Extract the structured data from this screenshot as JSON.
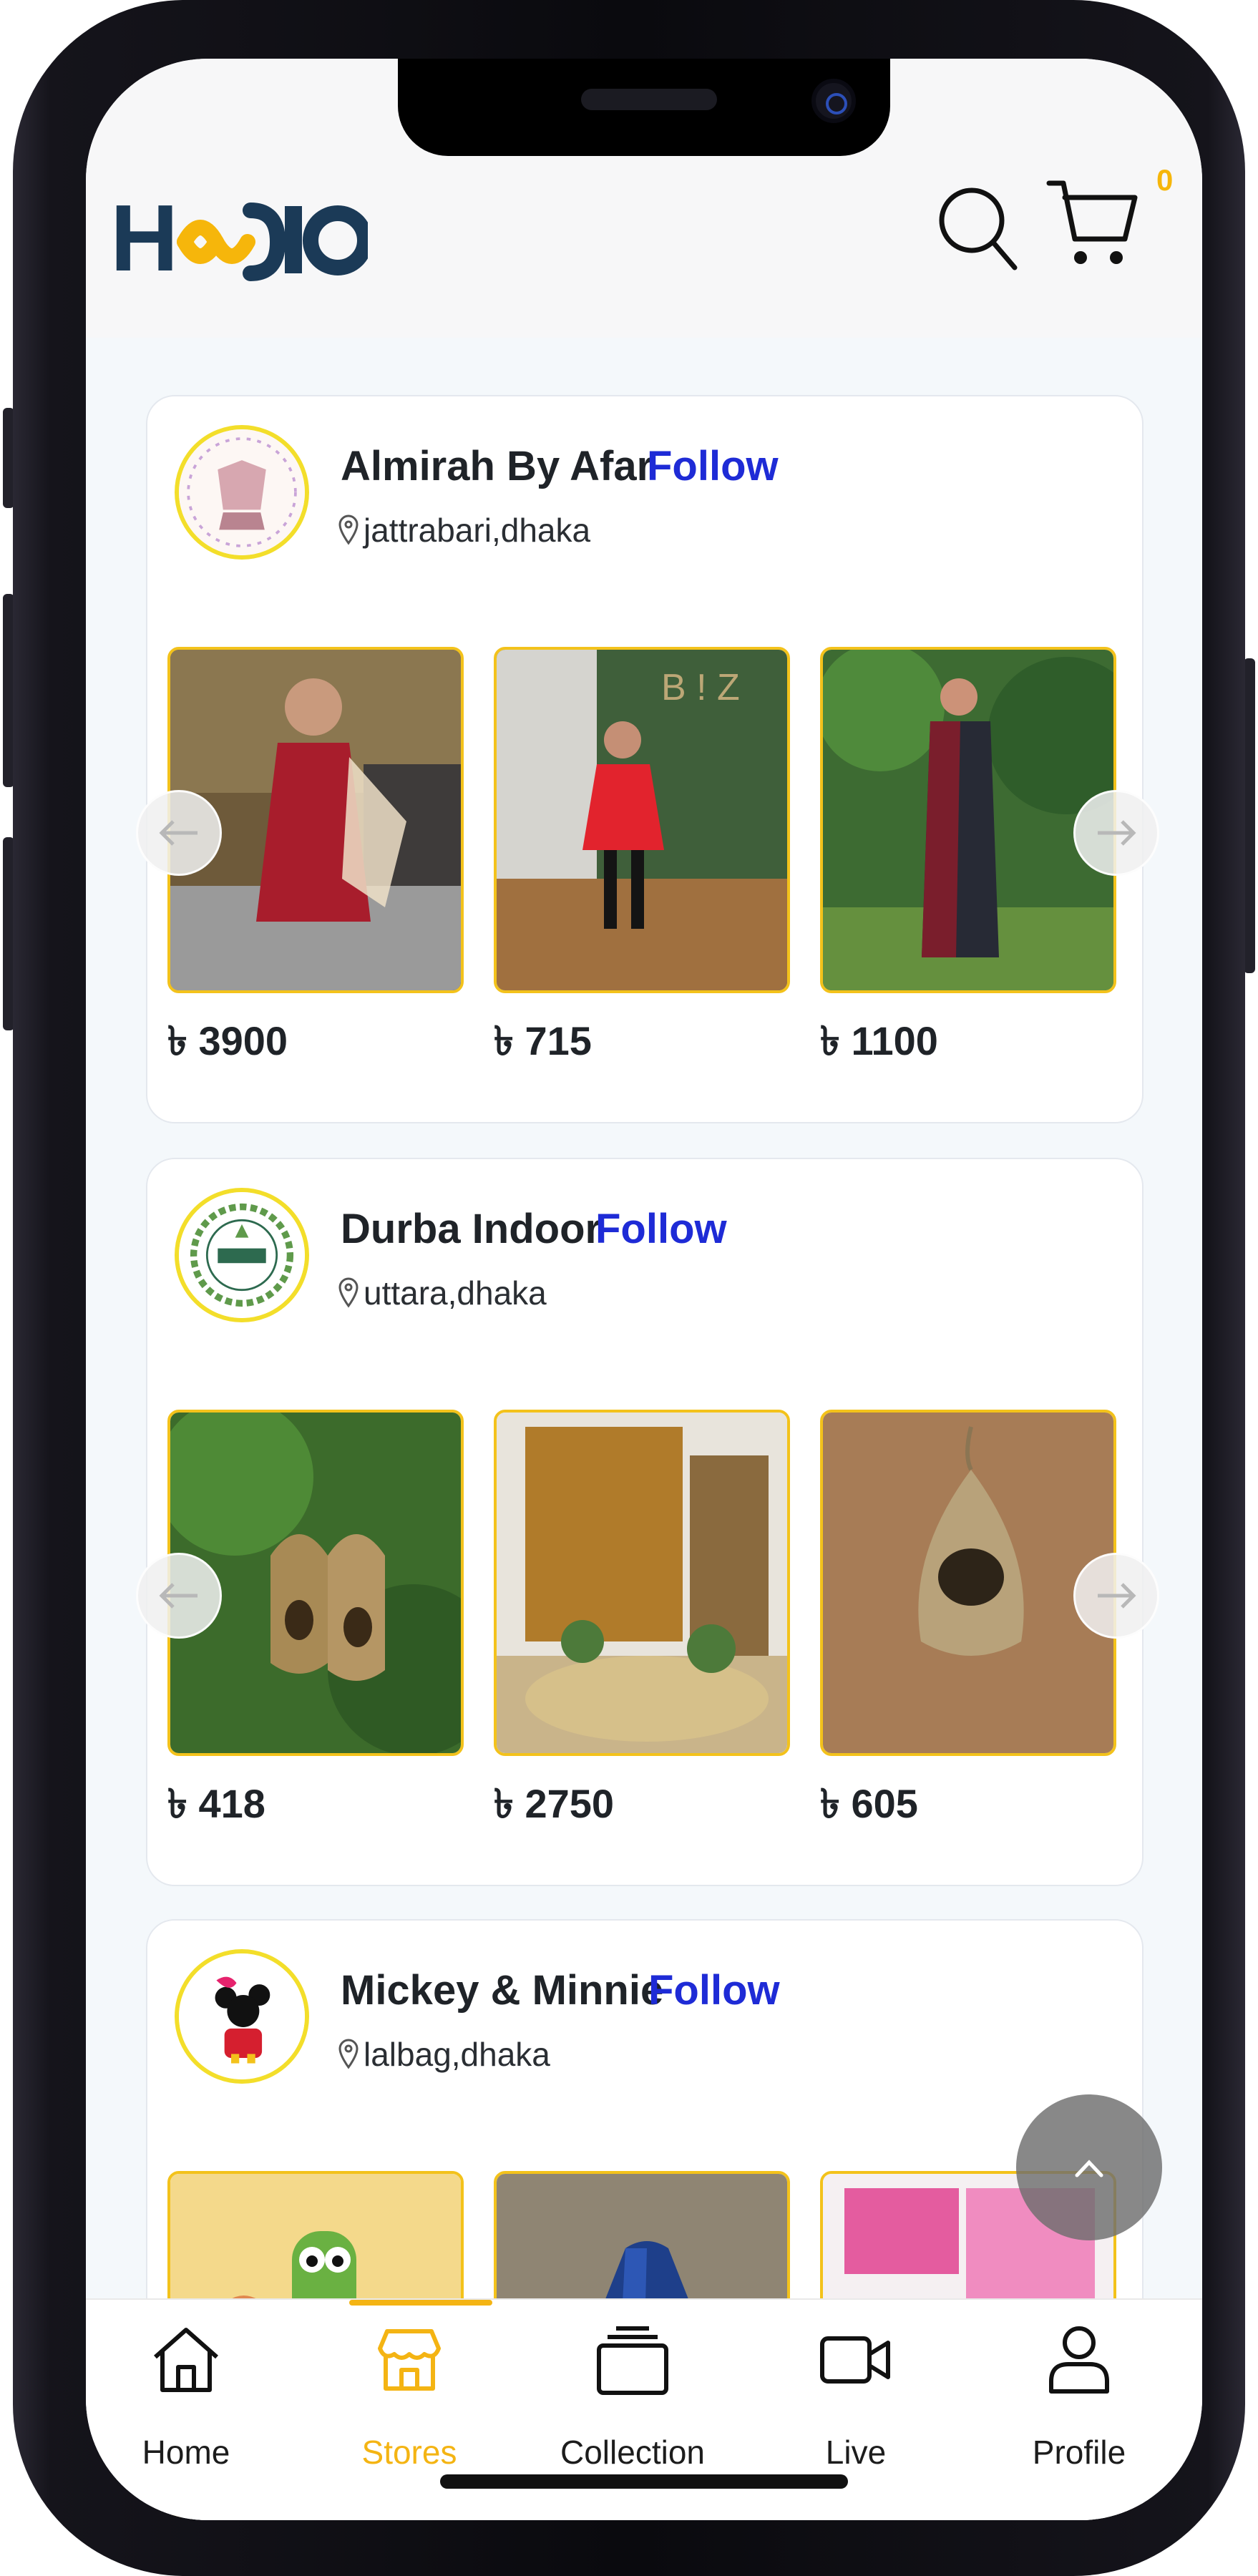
{
  "header": {
    "logo_text": "HOSIO",
    "cart_count": "0"
  },
  "stores": [
    {
      "name": "Almirah By Afar",
      "follow_label": "Follow",
      "location": "jattrabari,dhaka",
      "products": [
        {
          "price": "৳ 3900"
        },
        {
          "price": "৳ 715"
        },
        {
          "price": "৳ 1100"
        }
      ]
    },
    {
      "name": "Durba Indoor",
      "follow_label": "Follow",
      "location": "uttara,dhaka",
      "products": [
        {
          "price": "৳ 418"
        },
        {
          "price": "৳ 2750"
        },
        {
          "price": "৳ 605"
        }
      ]
    },
    {
      "name": "Mickey & Minnie",
      "follow_label": "Follow",
      "location": "lalbag,dhaka",
      "products": [
        {
          "price": ""
        },
        {
          "price": ""
        },
        {
          "price": ""
        }
      ]
    }
  ],
  "nav": {
    "items": [
      {
        "label": "Home",
        "icon": "home-icon"
      },
      {
        "label": "Stores",
        "icon": "store-icon",
        "active": true
      },
      {
        "label": "Collection",
        "icon": "collection-icon"
      },
      {
        "label": "Live",
        "icon": "video-icon"
      },
      {
        "label": "Profile",
        "icon": "user-icon"
      }
    ]
  },
  "colors": {
    "accent": "#f4b413",
    "follow": "#1e2bd6",
    "brand_dark": "#1b3a57"
  }
}
